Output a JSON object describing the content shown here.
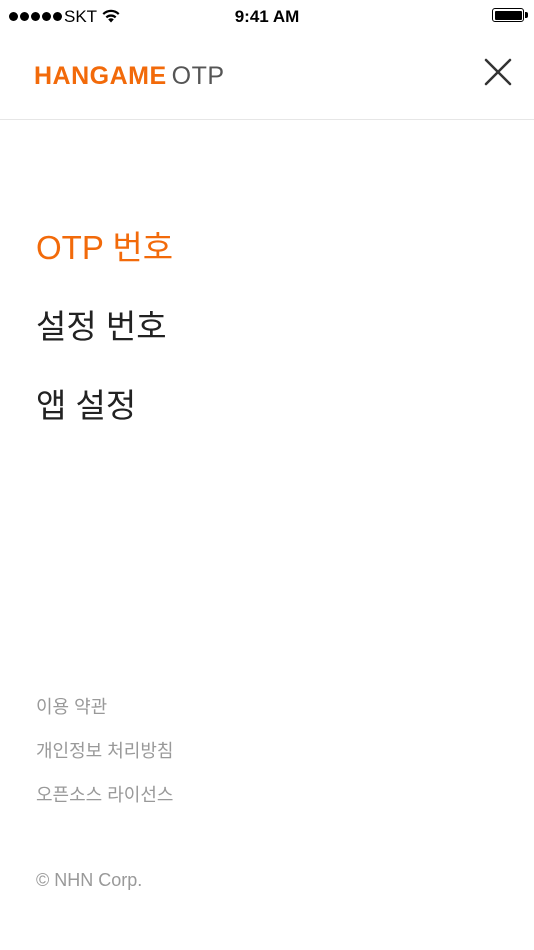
{
  "status_bar": {
    "carrier": "SKT",
    "time": "9:41 AM",
    "signal_icon": "signal-dots-icon",
    "wifi_icon": "wifi-icon",
    "battery_icon": "battery-icon"
  },
  "header": {
    "logo_brand": "HANGAME",
    "logo_product": "OTP",
    "close_icon": "close-icon"
  },
  "menu": {
    "items": [
      {
        "label": "OTP 번호",
        "active": true
      },
      {
        "label": "설정 번호",
        "active": false
      },
      {
        "label": "앱 설정",
        "active": false
      }
    ]
  },
  "footer": {
    "links": [
      {
        "label": "이용 약관"
      },
      {
        "label": "개인정보 처리방침"
      },
      {
        "label": "오픈소스 라이선스"
      }
    ],
    "copyright": "© NHN Corp."
  },
  "colors": {
    "accent": "#f26a0a",
    "text_primary": "#222222",
    "text_secondary": "#999999",
    "logo_secondary": "#555555",
    "divider": "#e6e6e6"
  }
}
